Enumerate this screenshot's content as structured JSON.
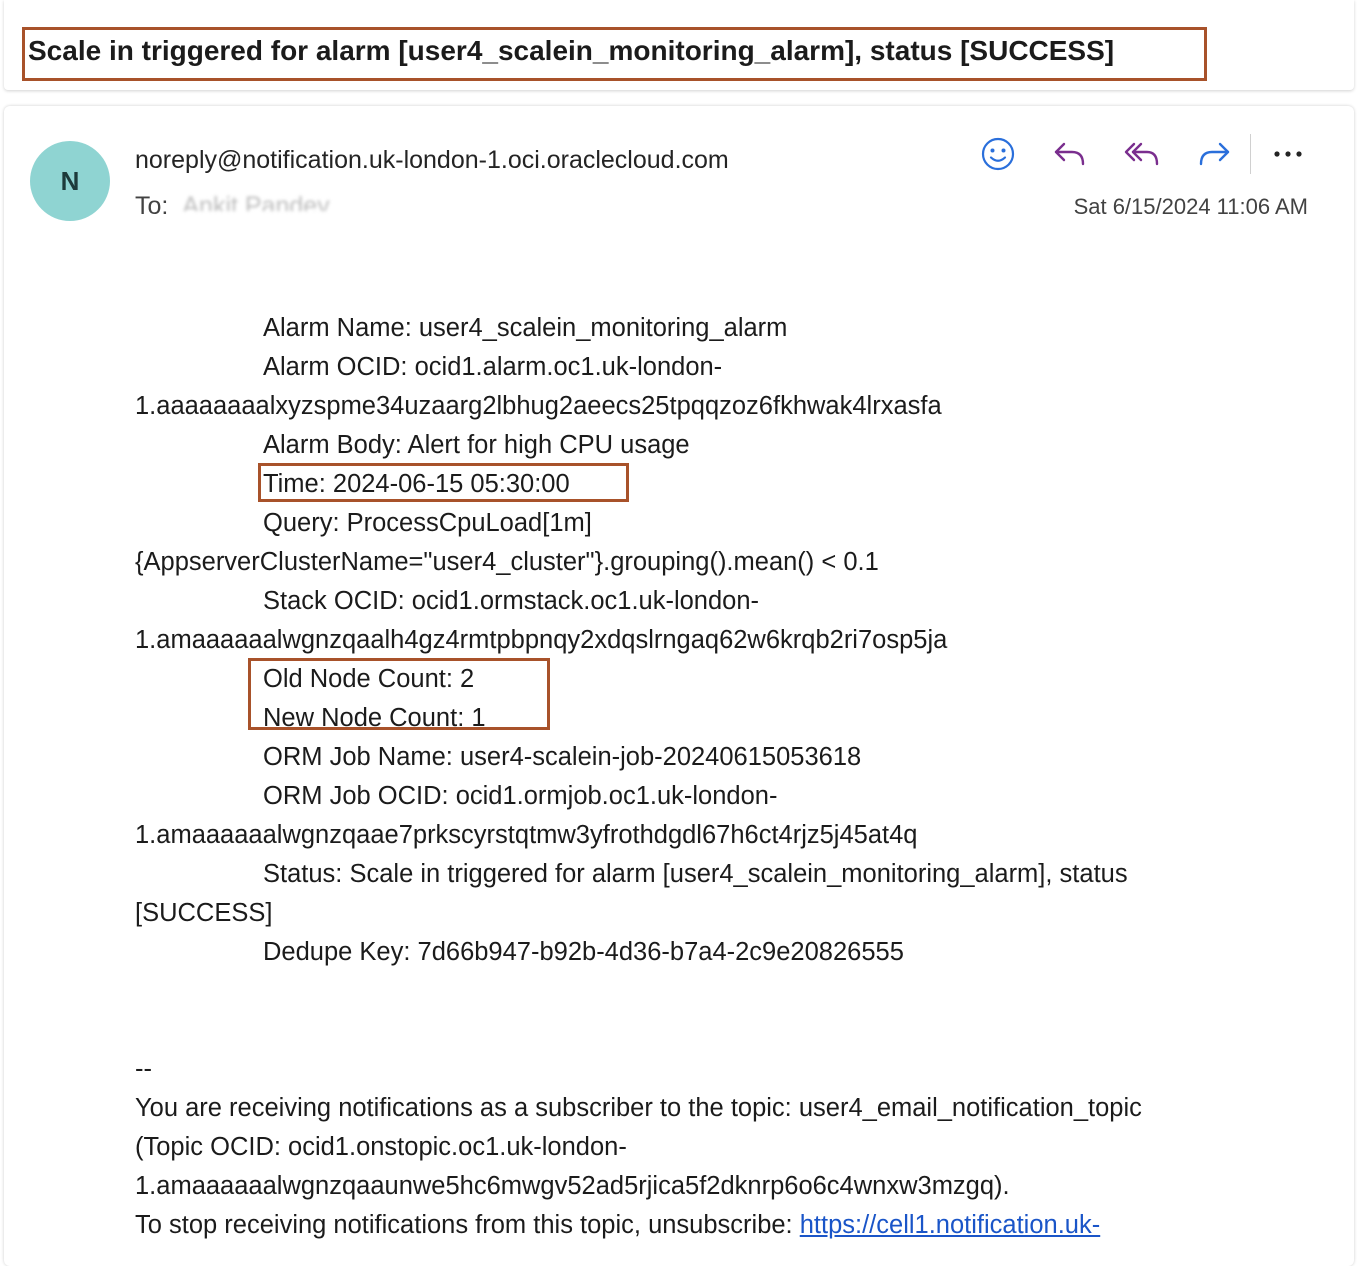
{
  "subject": "Scale in triggered for alarm [user4_scalein_monitoring_alarm], status [SUCCESS]",
  "header": {
    "avatar_initial": "N",
    "sender": "noreply@notification.uk-london-1.oci.oraclecloud.com",
    "to_label": "To:",
    "recipient": "Ankit Pandey",
    "timestamp": "Sat 6/15/2024 11:06 AM"
  },
  "toolbar": {
    "icons": [
      "emoji-icon",
      "reply-icon",
      "reply-all-icon",
      "forward-icon",
      "more-icon"
    ],
    "more_label": "···"
  },
  "body": {
    "alarm_name": "Alarm Name: user4_scalein_monitoring_alarm",
    "alarm_ocid_1": "Alarm OCID: ocid1.alarm.oc1.uk-london-",
    "alarm_ocid_2": "1.aaaaaaaalxyzspme34uzaarg2lbhug2aeecs25tpqqzoz6fkhwak4lrxasfa",
    "alarm_body": "Alarm Body: Alert for high CPU usage",
    "time": "Time: 2024-06-15 05:30:00",
    "query_1": "Query: ProcessCpuLoad[1m]",
    "query_2": "{AppserverClusterName=\"user4_cluster\"}.grouping().mean() < 0.1",
    "stack_ocid_1": "Stack OCID: ocid1.ormstack.oc1.uk-london-",
    "stack_ocid_2": "1.amaaaaaalwgnzqaalh4gz4rmtpbpnqy2xdqslrngaq62w6krqb2ri7osp5ja",
    "old_node_count": "Old Node Count: 2",
    "new_node_count": "New Node Count: 1",
    "orm_job_name": "ORM Job Name: user4-scalein-job-20240615053618",
    "orm_job_ocid_1": "ORM Job OCID: ocid1.ormjob.oc1.uk-london-",
    "orm_job_ocid_2": "1.amaaaaaalwgnzqaae7prkscyrstqtmw3yfrothdgdl67h6ct4rjz5j45at4q",
    "status_1": "Status: Scale in triggered for alarm [user4_scalein_monitoring_alarm], status",
    "status_2": "[SUCCESS]",
    "dedupe_key": "Dedupe Key: 7d66b947-b92b-4d36-b7a4-2c9e20826555",
    "separator": "--",
    "footer_1": "You are receiving notifications as a subscriber to the topic: user4_email_notification_topic",
    "footer_2": "(Topic OCID: ocid1.onstopic.oc1.uk-london-",
    "footer_3": "1.amaaaaaalwgnzqaaunwe5hc6mwgv52ad5rjica5f2dknrp6o6c4wnxw3mzgq).",
    "footer_4": "To stop receiving notifications from this topic, unsubscribe: ",
    "unsubscribe_link": "https://cell1.notification.uk-"
  },
  "colors": {
    "highlight_box": "#a8522a",
    "avatar_bg": "#8fd4d2",
    "icon_blue": "#2a6fdb",
    "icon_purple": "#7a2e8e",
    "link": "#1a55c8"
  }
}
